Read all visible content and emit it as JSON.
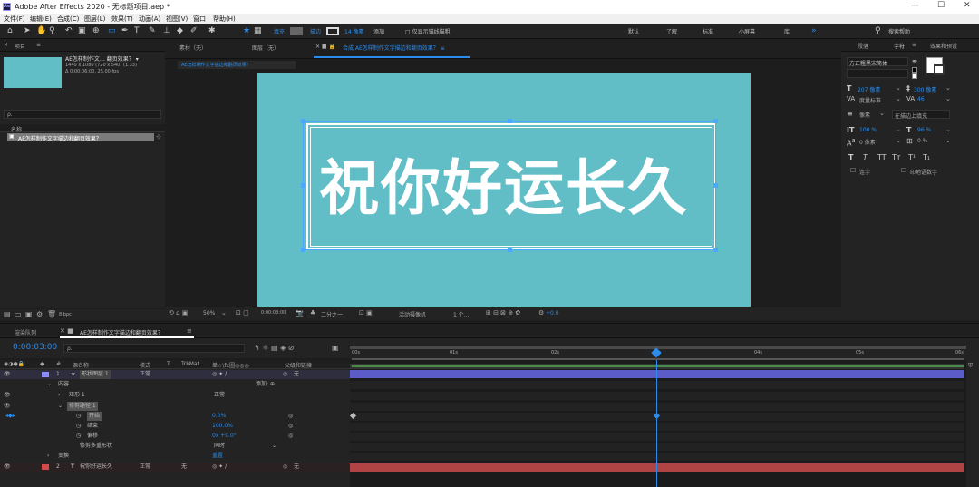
{
  "app": {
    "title": "Adobe After Effects 2020 - 无标题项目.aep *",
    "logo_text": "Ae"
  },
  "window_controls": {
    "minimize": "—",
    "maximize": "☐",
    "close": "✕"
  },
  "menu": [
    "文件(F)",
    "编辑(E)",
    "合成(C)",
    "图层(L)",
    "效果(T)",
    "动画(A)",
    "视图(V)",
    "窗口",
    "帮助(H)"
  ],
  "toolbar": {
    "fill_label": "填充",
    "stroke_label": "描边",
    "stroke_width": "14 像素",
    "add_label": "添加",
    "snap_label": "□ 仅显示锚线描粗",
    "workspaces": [
      "默认",
      "了解",
      "标准",
      "小屏幕",
      "库"
    ],
    "search_placeholder": "搜索帮助"
  },
  "project": {
    "title": "项目",
    "comp_name": "AE怎样制作文… 翻页效果？ ▾",
    "comp_size": "1440 x 1080 (720 x 540) (1.33)",
    "comp_duration": "Δ 0:00:06:00, 25.00 fps",
    "search_placeholder": "ρ.",
    "col_name": "名称",
    "item_name": "AE怎样制作文字描边和翻页效果？",
    "bpc": "8 bpc",
    "thumb_color": "#61bec7"
  },
  "viewer": {
    "tabs": [
      "素材（无）",
      "图层（无）"
    ],
    "comp_tab": "合成 AE怎样制作文字描边和翻页效果？ ≡",
    "breadcrumb": "AE怎样制作文字描边和翻页效果？",
    "canvas_text": "祝你好运长久",
    "canvas_color": "#61bec7",
    "zoom": "50%",
    "timecode": "0:00:03:00",
    "resolution": "二分之一",
    "camera": "活动摄像机",
    "views": "1 个…",
    "exposure": "+0.0"
  },
  "character_panel": {
    "tabs": [
      "段落",
      "字符",
      "效果和预设"
    ],
    "font_family": "方正粗黑宋简体",
    "font_style": "",
    "font_size": "207 像素",
    "leading": "300 像素",
    "kerning": "度量标准",
    "tracking": "46",
    "stroke_size": "像素",
    "stroke_mode": "在描边上填充",
    "vscale": "100 %",
    "hscale": "96 %",
    "baseline": "0 像素",
    "tsume": "0 %",
    "styles": [
      "T",
      "T",
      "TT",
      "Tт",
      "T¹",
      "T₁"
    ],
    "ligature": "连字",
    "hindi": "印地语数字"
  },
  "timeline": {
    "render_tab": "渲染队列",
    "comp_tab": "AE怎样制作文字描边和翻页效果？",
    "timecode": "0:00:03:00",
    "search_placeholder": "ρ.",
    "col_headers": {
      "num": "#",
      "name": "源名称",
      "mode": "模式",
      "t": "T",
      "trkmat": "TrkMat",
      "switches": "单☆\\fx圈◎◎◎",
      "parent": "父级和链接"
    },
    "ruler": [
      "00s",
      "01s",
      "02s",
      "03s",
      "04s",
      "05s",
      "06s"
    ],
    "layers": [
      {
        "num": "1",
        "name": "形状图层 1",
        "mode": "正常",
        "parent": "无",
        "color": "#8d8dff"
      },
      {
        "num": "2",
        "name": "祝你好运长久",
        "mode": "正常",
        "trkmat": "无",
        "parent": "无",
        "color": "#d64949"
      }
    ],
    "props": {
      "contents": "内容",
      "add": "添加: ",
      "rect": "矩形 1",
      "rect_mode": "正常",
      "trim": "修剪路径 1",
      "start": "开始",
      "start_val": "0.0%",
      "end": "结束",
      "end_val": "100.0%",
      "offset": "偏移",
      "offset_val": "0x +0.0°",
      "trim_multi": "修剪多重形状",
      "trim_multi_val": "同时",
      "transform": "变换",
      "reset": "重置"
    }
  }
}
